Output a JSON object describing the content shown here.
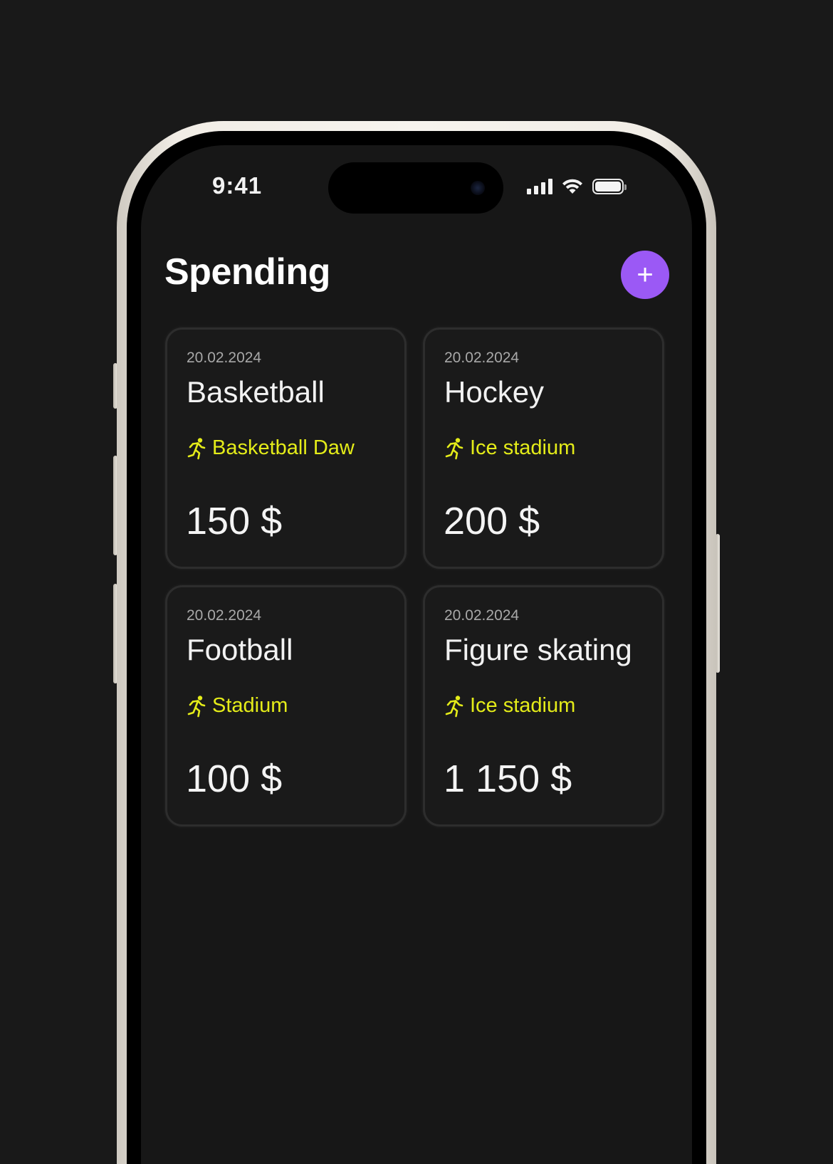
{
  "status_bar": {
    "time": "9:41",
    "icons": [
      "signal-icon",
      "wifi-icon",
      "battery-icon"
    ]
  },
  "header": {
    "title": "Spending",
    "add_button_label": "+"
  },
  "colors": {
    "background": "#171717",
    "accent": "#9b59f5",
    "location": "#e4ec19"
  },
  "cards": [
    {
      "date": "20.02.2024",
      "title": "Basketball",
      "location": "Basketball Daw",
      "amount": "150 $",
      "icon": "running-person-icon"
    },
    {
      "date": "20.02.2024",
      "title": "Hockey",
      "location": "Ice stadium",
      "amount": "200 $",
      "icon": "running-person-icon"
    },
    {
      "date": "20.02.2024",
      "title": "Football",
      "location": "Stadium",
      "amount": "100 $",
      "icon": "running-person-icon"
    },
    {
      "date": "20.02.2024",
      "title": "Figure skating",
      "location": "Ice stadium",
      "amount": "1 150 $",
      "icon": "running-person-icon"
    }
  ]
}
